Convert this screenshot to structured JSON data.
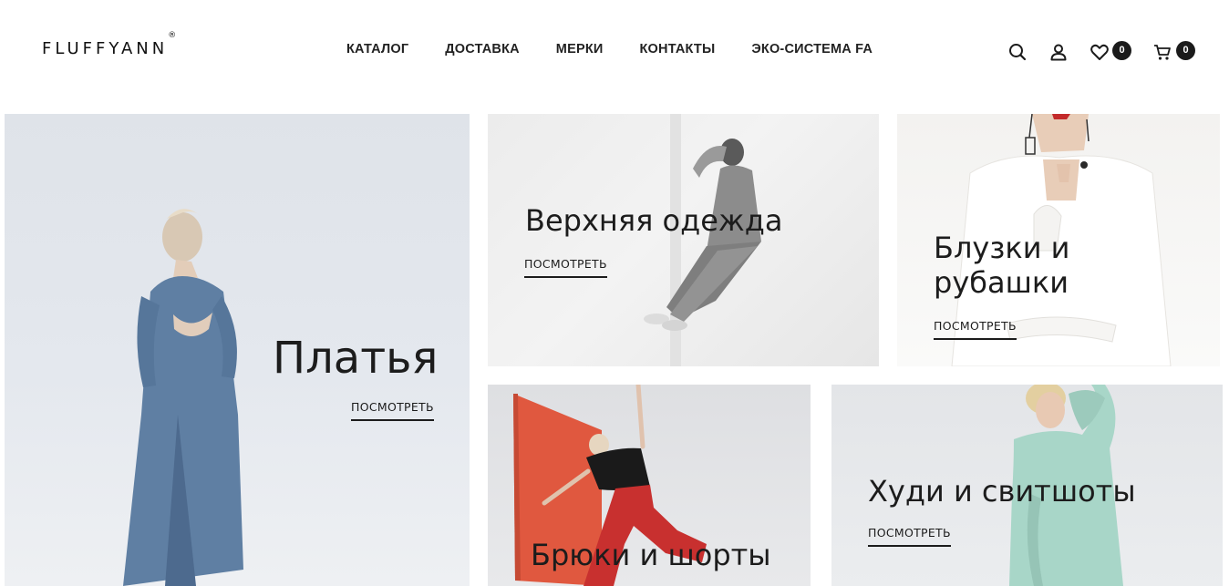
{
  "header": {
    "logo": "FluffyAnn",
    "logo_mark": "®",
    "nav": [
      {
        "label": "КАТАЛОГ"
      },
      {
        "label": "ДОСТАВКА"
      },
      {
        "label": "МЕРКИ"
      },
      {
        "label": "КОНТАКТЫ"
      },
      {
        "label": "ЭКО-СИСТЕМА FA"
      }
    ],
    "icons": {
      "search": "search-icon",
      "account": "user-icon",
      "wishlist": "heart-icon",
      "cart": "cart-icon"
    },
    "wishlist_count": "0",
    "cart_count": "0"
  },
  "categories": [
    {
      "title": "Платья",
      "link": "ПОСМОТРЕТЬ"
    },
    {
      "title": "Верхняя одежда",
      "link": "ПОСМОТРЕТЬ"
    },
    {
      "title_line1": "Блузки и",
      "title_line2": "рубашки",
      "link": "ПОСМОТРЕТЬ"
    },
    {
      "title": "Брюки и шорты"
    },
    {
      "title": "Худи и свитшоты",
      "link": "ПОСМОТРЕТЬ"
    }
  ],
  "colors": {
    "text": "#1c1c1c",
    "badge": "#1b1b1b",
    "dress_blue": "#5f7fa3",
    "hoodie_mint": "#a8d6c8",
    "pants_red": "#c8302f",
    "panel_orange": "#e0583f"
  }
}
